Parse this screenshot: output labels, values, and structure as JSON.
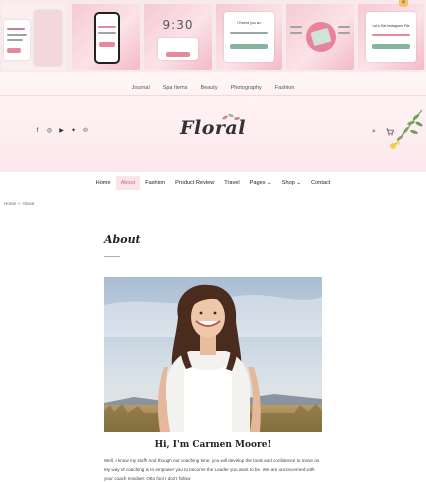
{
  "thumbnails": {
    "time_display": "9:30",
    "close_label": "×",
    "popup_heading_1": "I'll send you an",
    "popup_heading_2": "Get Instagram File",
    "popup_heading_3": "Let's Get Instagram File"
  },
  "top_menu": {
    "items": [
      "Journal",
      "Spa Items",
      "Beauty",
      "Photography",
      "Fashion"
    ]
  },
  "header": {
    "logo_text": "Floral",
    "social_icons": [
      "facebook-icon",
      "instagram-icon",
      "youtube-icon",
      "twitter-icon",
      "pinterest-icon"
    ],
    "social_glyphs": [
      "f",
      "◎",
      "▶",
      "✦",
      "℗"
    ],
    "search_glyph": "⌕",
    "cart_glyph": "🛒",
    "cart_count": "0"
  },
  "main_nav": {
    "items": [
      {
        "label": "Home"
      },
      {
        "label": "About"
      },
      {
        "label": "Fashion"
      },
      {
        "label": "Product Review"
      },
      {
        "label": "Travel"
      },
      {
        "label": "Pages ⌄"
      },
      {
        "label": "Shop ⌄"
      },
      {
        "label": "Contact"
      }
    ]
  },
  "breadcrumb": {
    "home": "Home",
    "separator": "»",
    "current": "About"
  },
  "content": {
    "title": "About",
    "intro_title": "Hi, I'm Carmen Moore!",
    "intro_text": "Well, I know my stuff! And though our coaching time, you will develop the tools and confidence to move on. My way of coaching is to empower you to become the Leader you want to be. We are unconcerned with your coach mindset. Otto fool I don't follow"
  },
  "colors": {
    "accent_pink": "#c96a7c",
    "hero_bg": "#fdeef1",
    "nav_active_bg": "#fbe3e7"
  }
}
